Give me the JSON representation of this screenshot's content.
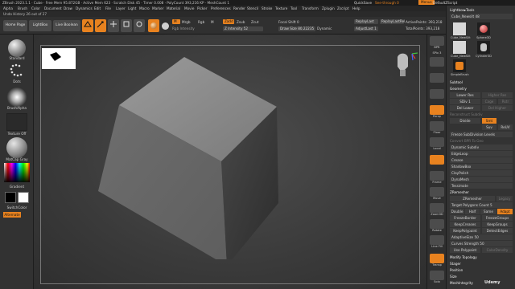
{
  "titlebar": {
    "title": "ZBrush 2023.1.1 · Cube · Free Mem 95.872GB · Active Mem 623 · Scratch Disk 45 · Timer 0.008 · PolyCount 393,216 KP · MeshCount 1",
    "quicksave": "QuickSave",
    "see_through": "See-through 0",
    "menus": "Menus",
    "script": "DefaultZScript"
  },
  "menubar": [
    "Alpha",
    "Brush",
    "Color",
    "Document",
    "Draw",
    "Dynamics",
    "Edit",
    "File",
    "Layer",
    "Light",
    "Macro",
    "Marker",
    "Material",
    "Movie",
    "Picker",
    "Preferences",
    "Render",
    "Stencil",
    "Stroke",
    "Texture",
    "Tool",
    "Transform",
    "Zplugin",
    "Zscript",
    "Help"
  ],
  "undo": "Undo History 26 out of 27",
  "toolbar": {
    "home_page": "Home Page",
    "lightbox": "LightBox",
    "live_boolean": "Live Boolean",
    "edit": "Edit",
    "draw": "Draw",
    "move": "Move",
    "scale": "Scale",
    "rotate": "Rotate",
    "mrgb": "Mrgb",
    "rgb": "Rgb",
    "m": "M",
    "zadd": "Zadd",
    "zsub": "Zsub",
    "zcut": "Zcut",
    "rgb_intensity": "Rgb Intensity",
    "z_intensity": "Z Intensity 52",
    "focal_shift": "Focal Shift 0",
    "draw_size": "Draw Size 80.22235",
    "dynamic": "Dynamic",
    "replay_last": "ReplayLast",
    "replay_last_rel": "ReplayLastRel",
    "adjust_last": "AdjustLast 1",
    "active_points": "ActivePoints: 393,218",
    "total_points": "TotalPoints: 393,218"
  },
  "left_panel": {
    "standard": "Standard",
    "dots": "Dots",
    "brush_alpha": "BrushAlpha",
    "texture_off": "Texture Off",
    "matcap_gray": "MatCap Gray",
    "gradient": "Gradient",
    "switch_color": "SwitchColor",
    "alternate": "Alternate"
  },
  "right_strip": {
    "bpr": "BPR",
    "spix": "SPix 3",
    "persp": "Persp",
    "floor": "Floor",
    "local": "Local",
    "frame": "Frame",
    "move": "Move",
    "zoom3d": "Zoom3D",
    "rotate": "Rotate",
    "line_fill": "Line Fill",
    "polyf": "PolyF",
    "transp": "Transp",
    "solo": "Solo",
    "xpose": "Xpose",
    "dynamic": "Dynamic"
  },
  "right_panel": {
    "lightbox_tools": "Lightbox▸Tools",
    "current_tool": "Cube_Newsilt 48",
    "thumbs": [
      "Cube_NewSilt",
      "Sphere3D",
      "Cube_NewSilt",
      "Cylinder3D",
      "SimpleBrush"
    ],
    "subtool": "Subtool",
    "geometry": "Geometry",
    "lower_res": "Lower Res",
    "higher_res": "Higher Res",
    "sdiv": "SDiv 1",
    "cage": "Cage",
    "rstr": "Rstr",
    "del_lower": "Del Lower",
    "del_higher": "Del Higher",
    "reconstruct_subdiv": "Reconstruct Subdiv",
    "divide": "Divide",
    "smt": "Smt",
    "suv": "Suv",
    "reuv": "ReUV",
    "freeze_subdivision": "Freeze SubDivision Levels",
    "convert_bpr": "Convert BPR To Geo",
    "dynamic_subdiv": "Dynamic Subdiv",
    "edge_loop": "EdgeLoop",
    "crease": "Crease",
    "shadowbox": "ShadowBox",
    "clay_polish": "ClayPolish",
    "dynamesh": "DynaMesh",
    "tessimate": "Tessimate",
    "zremesher_head": "ZRemesher",
    "zremesher_btn": "ZRemesher",
    "legacy": "Legacy",
    "target_polygons": "Target Polygons Count 5",
    "half": "Half",
    "same": "Same",
    "double": "Double",
    "adapt": "Adapt",
    "freeze_border": "FreezeBorder",
    "freeze_groups": "FreezeGroups",
    "keep_creases": "KeepCreases",
    "keep_groups": "KeepGroups",
    "detect_edges": "DetectEdges",
    "keep_polypaint": "KeepPolypaint",
    "adaptive_size": "AdaptiveSize 50",
    "curves_strength": "Curves Strength 50",
    "use_polypaint": "Use Polypaint",
    "color_density": "ColorDensity",
    "modify_topology": "Modify Topology",
    "stager": "Stager",
    "position": "Position",
    "size": "Size",
    "mesh_integrity": "MeshIntegrity"
  },
  "watermark": "Udemy",
  "colors": {
    "accent": "#e8821f",
    "viewport": "#444444",
    "panel": "#333333"
  }
}
